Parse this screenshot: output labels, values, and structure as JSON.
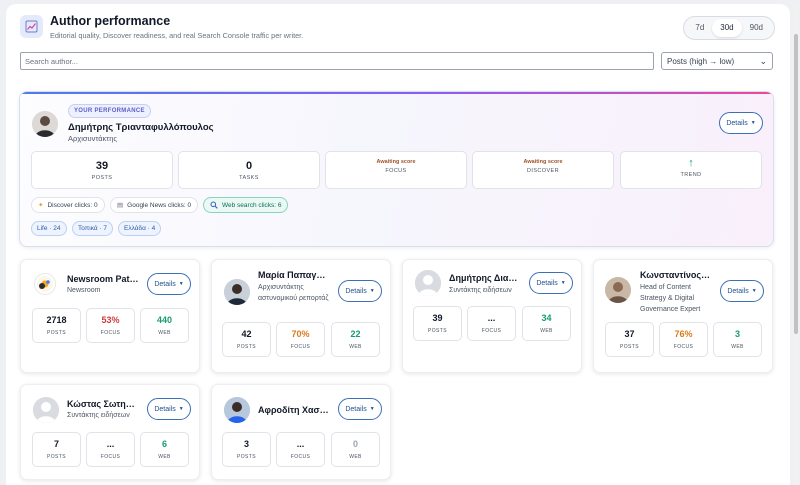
{
  "header": {
    "title": "Author performance",
    "subtitle": "Editorial quality, Discover readiness, and real Search Console traffic per writer.",
    "icon": "chart-icon",
    "ranges": [
      "7d",
      "30d",
      "90d"
    ],
    "active_range": "30d"
  },
  "search": {
    "placeholder": "Search author..."
  },
  "sort": {
    "value": "Posts (high → low)"
  },
  "hero": {
    "badge": "YOUR PERFORMANCE",
    "name": "Δημήτρης Τριανταφυλλόπουλος",
    "role": "Αρχισυντάκτης",
    "details_label": "Details",
    "stats": [
      {
        "value": "39",
        "label": "POSTS"
      },
      {
        "value": "0",
        "label": "TASKS"
      },
      {
        "value": "Awaiting score",
        "label": "FOCUS"
      },
      {
        "value": "Awaiting score",
        "label": "DISCOVER"
      },
      {
        "value": "↑",
        "label": "TREND"
      }
    ],
    "sources": [
      {
        "label": "Discover clicks: 0"
      },
      {
        "label": "Google News clicks: 0"
      },
      {
        "label": "Web search clicks: 6"
      }
    ],
    "tags": [
      "Life · 24",
      "Τοπικά · 7",
      "Ελλάδα · 4"
    ]
  },
  "cards": [
    {
      "name": "Newsroom Pat…",
      "role": "Newsroom",
      "details_label": "Details",
      "posts": "2718",
      "focus": "53%",
      "web": "440"
    },
    {
      "name": "Μαρία Παπαγ…",
      "role": "Αρχισυντάκτης αστυνομικού ρεπορτάζ",
      "details_label": "Details",
      "posts": "42",
      "focus": "70%",
      "web": "22"
    },
    {
      "name": "Δημήτρης Δια…",
      "role": "Συντάκτης ειδήσεων",
      "details_label": "Details",
      "posts": "39",
      "focus": "...",
      "web": "34"
    },
    {
      "name": "Κωνσταντίνος…",
      "role": "Head of Content Strategy & Digital Governance Expert",
      "details_label": "Details",
      "posts": "37",
      "focus": "76%",
      "web": "3"
    },
    {
      "name": "Κώστας Σωτη…",
      "role": "Συντάκτης ειδήσεων",
      "details_label": "Details",
      "posts": "7",
      "focus": "...",
      "web": "6"
    },
    {
      "name": "Αφροδίτη Χασ…",
      "role": "",
      "details_label": "Details",
      "posts": "3",
      "focus": "...",
      "web": "0"
    }
  ],
  "stat_labels": {
    "posts": "POSTS",
    "focus": "FOCUS",
    "web": "WEB"
  },
  "colors": {
    "accent": "#5b5fc7",
    "good": "#169c6d",
    "bad": "#d03a3a",
    "warn": "#d97a1a",
    "button_border": "#3b6fb6"
  }
}
